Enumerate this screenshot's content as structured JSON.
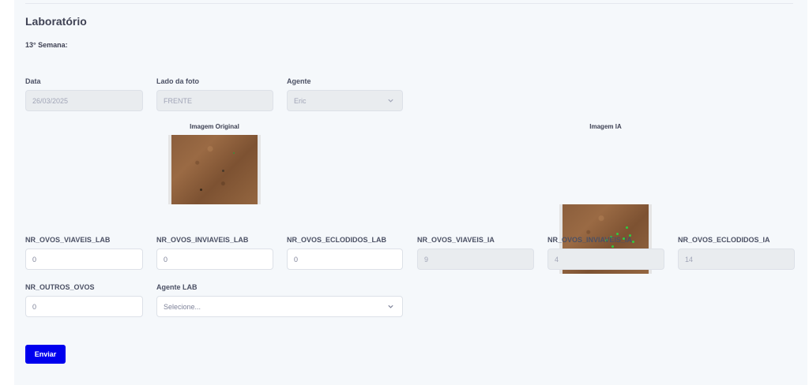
{
  "header": {
    "title": "Laboratório",
    "week": "13° Semana:"
  },
  "form_top": {
    "data": {
      "label": "Data",
      "value": "26/03/2025"
    },
    "lado": {
      "label": "Lado da foto",
      "value": "FRENTE"
    },
    "agente": {
      "label": "Agente",
      "value": "Eric"
    }
  },
  "images": {
    "original_label": "Imagem Original",
    "ia_label": "Imagem IA"
  },
  "counts": {
    "viaveis_lab": {
      "label": "NR_OVOS_VIAVEIS_LAB",
      "value": "0"
    },
    "inviaveis_lab": {
      "label": "NR_OVOS_INVIAVEIS_LAB",
      "value": "0"
    },
    "eclodidos_lab": {
      "label": "NR_OVOS_ECLODIDOS_LAB",
      "value": "0"
    },
    "viaveis_ia": {
      "label": "NR_OVOS_VIAVEIS_IA",
      "value": "9"
    },
    "inviaveis_ia": {
      "label": "NR_OVOS_INVIAVEIS_IA",
      "value": "4"
    },
    "eclodidos_ia": {
      "label": "NR_OVOS_ECLODIDOS_IA",
      "value": "14"
    },
    "outros": {
      "label": "NR_OUTROS_OVOS",
      "value": "0"
    }
  },
  "agente_lab": {
    "label": "Agente LAB",
    "placeholder": "Selecione..."
  },
  "submit": {
    "label": "Enviar"
  },
  "colors": {
    "primary_button": "#0000ee",
    "panel_bg": "#f5f8fb",
    "disabled_bg": "#e9ecef"
  },
  "icons": {
    "select": "chevron-down-icon"
  }
}
